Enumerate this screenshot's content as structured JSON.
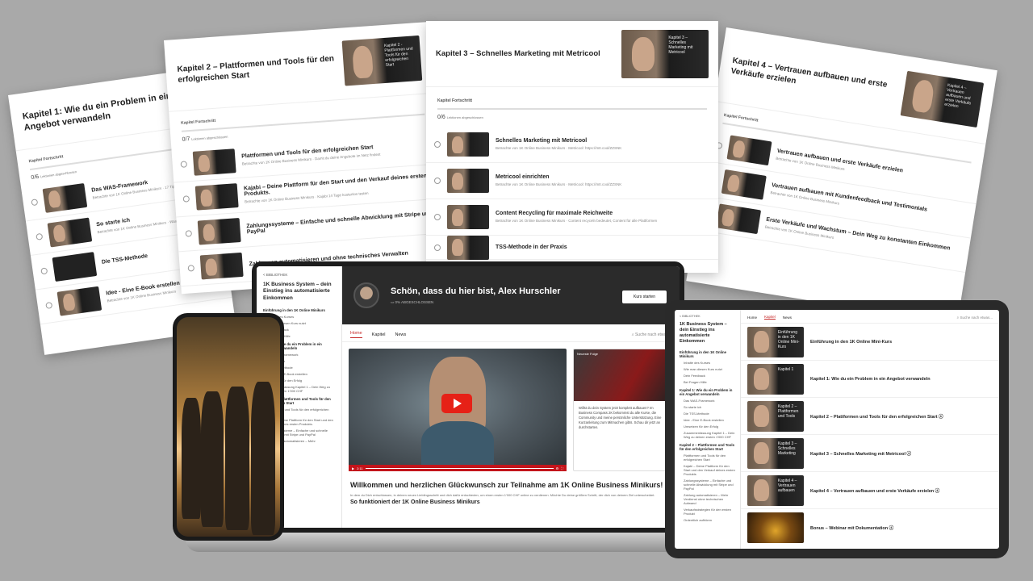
{
  "card1": {
    "title": "Kapitel 1: Wie du ein Problem in ein Angebot verwandeln",
    "progress_label": "Kapitel Fortschritt",
    "count": "0/6",
    "count_sub": "Lektionen abgeschlossen",
    "lessons": [
      {
        "title": "Das WAS-Framework",
        "desc": "Betrachte von 1K Online Business Minikurs · 17 Tipps zum Start"
      },
      {
        "title": "So starte ich",
        "desc": "Betrachte von 1K Online Business Minikurs · Was ich getan habe"
      },
      {
        "title": "Die TSS-Methode",
        "desc": ""
      },
      {
        "title": "Idee - Eine E-Book erstellen",
        "desc": "Betrachte von 1K Online Business Minikurs"
      }
    ]
  },
  "card2": {
    "title": "Kapitel 2 – Plattformen und Tools für den erfolgreichen Start",
    "thumb_text": "Kapitel 2 - Plattformen und Tools für den erfolgreichen Start",
    "progress_label": "Kapitel Fortschritt",
    "count": "0/7",
    "count_sub": "Lektionen abgeschlossen",
    "lessons": [
      {
        "title": "Plattformen und Tools für den erfolgreichen Start",
        "desc": "Betrachte von 1K Online Business Minikurs · Damit du deine Angebote im Netz findest"
      },
      {
        "title": "Kajabi – Deine Plattform für den Start und den Verkauf deines ersten Produkts.",
        "desc": "Betrachte von 1K Online Business Minikurs · Kajabi 14 Tage kostenlos testen"
      },
      {
        "title": "Zahlungssysteme – Einfache und schnelle Abwicklung mit Stripe und PayPal",
        "desc": ""
      },
      {
        "title": "Zahlungen automatisieren und ohne technisches Verwalten",
        "desc": ""
      }
    ]
  },
  "card3": {
    "title": "Kapitel 3 – Schnelles Marketing mit Metricool",
    "thumb_text": "Kapitel 3 – Schnelles Marketing mit Metricool",
    "progress_label": "Kapitel Fortschritt",
    "count": "0/6",
    "count_sub": "Lektionen abgeschlossen",
    "lessons": [
      {
        "title": "Schnelles Marketing mit Metricool",
        "desc": "Betrachte von 1K Online Business Minikurs · Metricool: https://mtr.cool/ZZSNK"
      },
      {
        "title": "Metricool einrichten",
        "desc": "Betrachte von 1K Online Business Minikurs · Metricool: https://mtr.cool/ZZSNK"
      },
      {
        "title": "Content Recycling für maximale Reichweite",
        "desc": "Betrachte von 1K Online Business Minikurs · Content recyceln bedeutet, Content für alle Plattformen"
      },
      {
        "title": "TSS-Methode in der Praxis",
        "desc": ""
      }
    ]
  },
  "card4": {
    "title": "Kapitel 4 – Vertrauen aufbauen und erste Verkäufe erzielen",
    "thumb_text": "Kapitel 4 – Vertrauen aufbauen und erste Verkäufe erzielen",
    "progress_label": "Kapitel Fortschritt",
    "lessons": [
      {
        "title": "Vertrauen aufbauen und erste Verkäufe erzielen",
        "desc": "Betrachte von 1K Online Business Minikurs"
      },
      {
        "title": "Vertrauen aufbauen mit Kundenfeedback und Testimonials",
        "desc": "Betrachte von 1K Online Business Minikurs"
      },
      {
        "title": "Erste Verkäufe und Wachstum – Dein Weg zu konstanten Einkommen",
        "desc": "Betrachte von 1K Online Business Minikurs"
      }
    ]
  },
  "laptop": {
    "back": "< BIBLIOTHEK",
    "course_title": "1K Business System – dein Einstieg ins automatisierte Einkommen",
    "sidebar": [
      {
        "head": "Einführung in den 1K Online Minikurs",
        "items": [
          "Inhalte des Kurses",
          "Wie man diesen Kurs nutzt",
          "Dein Feedback",
          "Bei Fragen Hilfe"
        ]
      },
      {
        "head": "Kapitel 1: Wie du ein Problem in ein Angebot verwandeln",
        "items": [
          "Das WAS-Framework",
          "So starte ich",
          "Die TSS-Methode",
          "Idee - Eine E-Book erstellen",
          "Umsetzen für den Erfolg",
          "Zusammenfassung Kapitel 1 – Dein Weg zu deinen ersten 1'000 CHF"
        ]
      },
      {
        "head": "Kapitel 2 – Plattformen und Tools für den erfolgreichen Start",
        "items": [
          "Plattformen und Tools für den erfolgreichen Start",
          "Kajabi – Deine Plattform für den Start und den Verkauf deines ersten Produkts.",
          "Zahlungssysteme – Einfache und schnelle Abwicklung mit Stripe und PayPal",
          "Zahlungen automatisieren – Mehr"
        ]
      }
    ],
    "greeting": "Schön, dass du hier bist, Alex Hurschler",
    "progress_sub": "0% ABGESCHLOSSEN",
    "start_button": "Kurs starten",
    "tabs": [
      "Home",
      "Kapitel",
      "News"
    ],
    "search_placeholder": "Suche nach etwas...",
    "video_time": "2:11",
    "side_card_label": "Neueste Folge",
    "side_card_text": "Willst du dein System jetzt komplett aufbauen? Im Business Compass 2K bekommst du alle Kurse, die Community und meine persönliche Unterstützung. Eine Kurzanleitung zum Mitmachen gibts. Schau dir jetzt an durchstarten.",
    "welcome_title": "Willkommen und herzlichen Glückwunsch zur Teilnahme am 1K Online Business Minikurs!",
    "welcome_text": "In dem du Dich entschlossen, in deinen neuen Lieblingsschritt und dich dafür entschieden, um einen ersten 1'000 CHF online zu verdienen. Möchte Du deine größten Schritt, der dich von deinem Ziel unterscheidet.",
    "welcome_sub": "So funktioniert der 1K Online Business Minikurs"
  },
  "tablet": {
    "back": "< BIBLIOTHEK",
    "course_title": "1K Business System – dein Einstieg ins automatisierte Einkommen",
    "tabs": [
      "Home",
      "Kapitel",
      "News"
    ],
    "search_placeholder": "Suche nach etwas...",
    "sidebar": [
      {
        "head": "Einführung in den 1K Online Minikurs",
        "items": [
          "Inhalte des Kurses",
          "Wie man diesen Kurs nutzt",
          "Dein Feedback",
          "Bei Fragen Hilfe"
        ]
      },
      {
        "head": "Kapitel 1: Wie du ein Problem in ein Angebot verwandeln",
        "items": [
          "Das WAS-Framework",
          "So starte ich",
          "Die TSS-Methode",
          "Idee - Eine E-Book erstellen",
          "Umsetzen für den Erfolg",
          "Zusammenfassung Kapitel 1 – Dein Weg zu deinen ersten 1'000 CHF"
        ]
      },
      {
        "head": "Kapitel 2 – Plattformen und Tools für den erfolgreichen Start",
        "items": [
          "Plattformen und Tools für den erfolgreichen Start",
          "Kajabi – Deine Plattform für den Start und den Verkauf deines ersten Produkts",
          "Zahlungssysteme – Einfache und schnelle Abwicklung mit Stripe und PayPal",
          "Zahlung automatisieren – Mehr Verdienst ohne technischen Aufwand",
          "Verkaufsstrategien für den ersten Produkt",
          "Ordentlich aufhören"
        ]
      }
    ],
    "chapters": [
      {
        "title": "Einführung in den 1K Online Mini-Kurs",
        "thumb": "Einführung in den 1K Online Mini-Kurs"
      },
      {
        "title": "Kapitel 1: Wie du ein Problem in ein Angebot verwandeln",
        "thumb": "Kapitel 1"
      },
      {
        "title": "Kapitel 2 – Plattformen und Tools für den erfolgreichen Start ⓢ",
        "thumb": "Kapitel 2 – Plattformen und Tools"
      },
      {
        "title": "Kapitel 3 – Schnelles Marketing mit Metricool ⓢ",
        "thumb": "Kapitel 3 – Schnelles Marketing"
      },
      {
        "title": "Kapitel 4 – Vertrauen aufbauen und erste Verkäufe erzielen ⓢ",
        "thumb": "Kapitel 4 – Vertrauen aufbauen"
      },
      {
        "title": "Bonus – Webinar mit Dokumentation ⓢ",
        "thumb": ""
      }
    ]
  },
  "colors": {
    "accent": "#c62828",
    "banner": "#2b2b2b",
    "background": "#a9a9a9"
  }
}
